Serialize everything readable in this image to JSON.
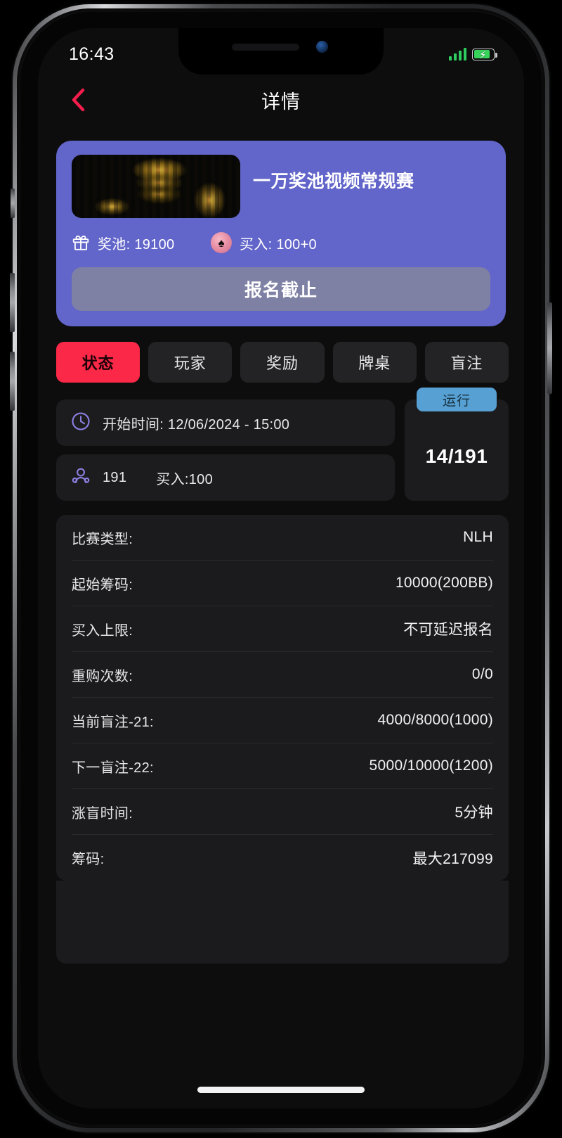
{
  "status_bar": {
    "time": "16:43",
    "signal_icon": "signal-bars-icon",
    "battery_icon": "battery-charging-icon",
    "battery_bolt": "⚡"
  },
  "header": {
    "back_icon": "back-chevron-icon",
    "title": "详情"
  },
  "hero": {
    "image_alt": "poker-chips-image",
    "title": "一万奖池视频常规赛",
    "prize_icon": "gift-icon",
    "prize_label": "奖池: 19100",
    "buyin_icon": "spade-icon",
    "buyin_label": "买入: 100+0",
    "cta_label": "报名截止",
    "card_color": "#6265c9",
    "cta_color": "#7f81a4"
  },
  "tabs": {
    "active_color": "#fb2847",
    "items": [
      {
        "label": "状态",
        "active": true
      },
      {
        "label": "玩家",
        "active": false
      },
      {
        "label": "奖励",
        "active": false
      },
      {
        "label": "牌桌",
        "active": false
      },
      {
        "label": "盲注",
        "active": false
      }
    ]
  },
  "status_section": {
    "clock_icon": "clock-icon",
    "start_time": "开始时间: 12/06/2024 - 15:00",
    "players_icon": "people-icon",
    "players_count": "191",
    "buyin_text": "买入:100",
    "state_badge": "运行",
    "state_badge_color": "#57a0d3",
    "remaining": "14/191"
  },
  "details": {
    "rows": [
      {
        "label": "比赛类型:",
        "value": "NLH"
      },
      {
        "label": "起始筹码:",
        "value": "10000(200BB)"
      },
      {
        "label": "买入上限:",
        "value": "不可延迟报名"
      },
      {
        "label": "重购次数:",
        "value": "0/0"
      },
      {
        "label": "当前盲注-21:",
        "value": "4000/8000(1000)"
      },
      {
        "label": "下一盲注-22:",
        "value": "5000/10000(1200)"
      },
      {
        "label": "涨盲时间:",
        "value": "5分钟"
      },
      {
        "label": "筹码:",
        "value": "最大217099"
      }
    ]
  }
}
